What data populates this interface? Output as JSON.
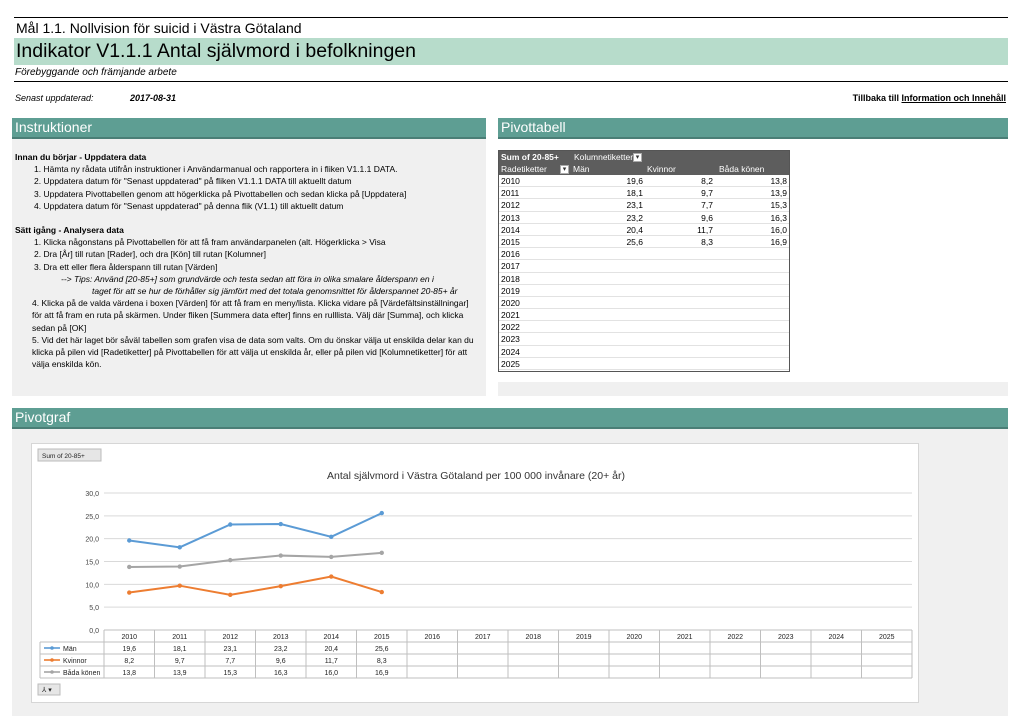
{
  "header": {
    "goal": "Mål 1.1. Nollvision för suicid i Västra Götaland",
    "indicator": "Indikator V1.1.1 Antal självmord i befolkningen",
    "subtitle": "Förebyggande och främjande arbete",
    "updated_label": "Senast uppdaterad:",
    "updated_value": "2017-08-31",
    "back_prefix": "Tillbaka till",
    "back_link": "Information och Innehåll"
  },
  "colors": {
    "band": "#5e9e93",
    "grey": "#f0f0f0",
    "pivot_header": "#5d5d5d",
    "man": "#5b9bd5",
    "kvinnor": "#ed7d31",
    "bada": "#a5a5a5"
  },
  "sections": {
    "instructions": "Instruktioner",
    "pivot": "Pivottabell",
    "pivotgraf": "Pivotgraf"
  },
  "instructions": {
    "h1": "Innan du börjar - Uppdatera data",
    "s1": [
      "1. Hämta ny rådata utifrån instruktioner i Användarmanual och rapportera in i fliken V1.1.1 DATA.",
      "2. Uppdatera datum för \"Senast uppdaterad\" på fliken V1.1.1 DATA till aktuellt datum",
      "3. Uppdatera Pivottabellen genom att högerklicka på Pivottabellen och sedan klicka på [Uppdatera]",
      "4. Uppdatera datum för \"Senast uppdaterad\" på denna flik (V1.1) till aktuellt datum"
    ],
    "h2": "Sätt igång - Analysera data",
    "s2": [
      "1. Klicka någonstans på Pivottabellen för att få fram användarpanelen (alt. Högerklicka > Visa",
      "2. Dra [År] till rutan [Rader], och dra [Kön] till rutan [Kolumner]",
      "3. Dra ett eller flera ålderspann till rutan [Värden]"
    ],
    "tip1": "--> Tips: Använd [20-85+] som grundvärde och testa sedan att föra in olika smalare ålderspann en i",
    "tip2": "taget för att se hur de förhåller sig jämfört med det totala genomsnittet för ålderspannet 20-85+ år",
    "p4": "4. Klicka på de valda värdena i boxen [Värden] för att få fram en meny/lista. Klicka vidare på [Värdefältsinställningar] för att få fram en ruta på skärmen. Under fliken [Summera data efter] finns en rulllista. Välj där [Summa], och klicka sedan på [OK]",
    "p5": "5. Vid det här laget bör såväl tabellen som grafen visa de data som valts. Om du önskar välja ut enskilda delar kan du klicka på pilen vid [Radetiketter] på Pivottabellen för att välja ut enskilda år, eller på pilen vid [Kolumnetiketter] för att välja enskilda kön."
  },
  "pivot": {
    "sum_label": "Sum of 20-85+",
    "col_label": "Kolumnetiketter",
    "row_label": "Radetiketter",
    "headers": [
      "Män",
      "Kvinnor",
      "Båda könen"
    ],
    "rows": [
      [
        "2010",
        "19,6",
        "8,2",
        "13,8"
      ],
      [
        "2011",
        "18,1",
        "9,7",
        "13,9"
      ],
      [
        "2012",
        "23,1",
        "7,7",
        "15,3"
      ],
      [
        "2013",
        "23,2",
        "9,6",
        "16,3"
      ],
      [
        "2014",
        "20,4",
        "11,7",
        "16,0"
      ],
      [
        "2015",
        "25,6",
        "8,3",
        "16,9"
      ],
      [
        "2016",
        "",
        "",
        ""
      ],
      [
        "2017",
        "",
        "",
        ""
      ],
      [
        "2018",
        "",
        "",
        ""
      ],
      [
        "2019",
        "",
        "",
        ""
      ],
      [
        "2020",
        "",
        "",
        ""
      ],
      [
        "2021",
        "",
        "",
        ""
      ],
      [
        "2022",
        "",
        "",
        ""
      ],
      [
        "2023",
        "",
        "",
        ""
      ],
      [
        "2024",
        "",
        "",
        ""
      ],
      [
        "2025",
        "",
        "",
        ""
      ]
    ]
  },
  "chart_data": {
    "type": "line",
    "title": "Antal självmord i Västra Götaland per 100 000 invånare (20+ år)",
    "field_button": "Sum of 20-85+",
    "categories": [
      "2010",
      "2011",
      "2012",
      "2013",
      "2014",
      "2015",
      "2016",
      "2017",
      "2018",
      "2019",
      "2020",
      "2021",
      "2022",
      "2023",
      "2024",
      "2025"
    ],
    "ylim": [
      0,
      30
    ],
    "yticks": [
      "0,0",
      "5,0",
      "10,0",
      "15,0",
      "20,0",
      "25,0",
      "30,0"
    ],
    "grid": true,
    "legend": "data-table-left",
    "series": [
      {
        "name": "Män",
        "values": [
          19.6,
          18.1,
          23.1,
          23.2,
          20.4,
          25.6
        ],
        "labels": [
          "19,6",
          "18,1",
          "23,1",
          "23,2",
          "20,4",
          "25,6"
        ],
        "color": "#5b9bd5"
      },
      {
        "name": "Kvinnor",
        "values": [
          8.2,
          9.7,
          7.7,
          9.6,
          11.7,
          8.3
        ],
        "labels": [
          "8,2",
          "9,7",
          "7,7",
          "9,6",
          "11,7",
          "8,3"
        ],
        "color": "#ed7d31"
      },
      {
        "name": "Båda könen",
        "values": [
          13.8,
          13.9,
          15.3,
          16.3,
          16.0,
          16.9
        ],
        "labels": [
          "13,8",
          "13,9",
          "15,3",
          "16,3",
          "16,0",
          "16,9"
        ],
        "color": "#a5a5a5"
      }
    ]
  }
}
